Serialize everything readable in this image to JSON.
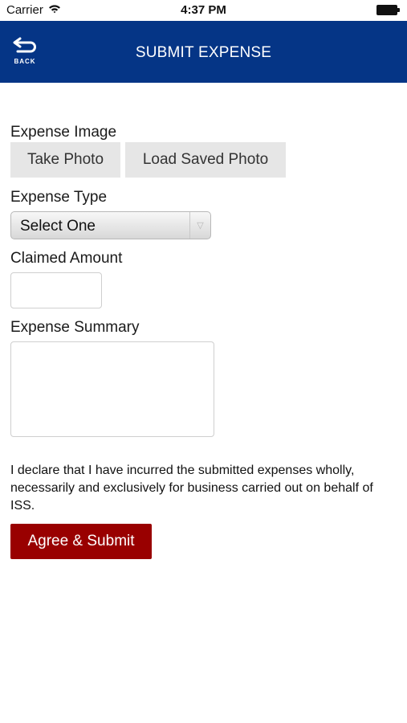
{
  "status_bar": {
    "carrier": "Carrier",
    "time": "4:37 PM",
    "wifi_icon": "wifi-icon",
    "battery_icon": "battery-icon"
  },
  "nav": {
    "back_label": "BACK",
    "back_icon": "back-arrow-icon",
    "title": "SUBMIT EXPENSE",
    "background_color": "#053586"
  },
  "form": {
    "expense_image_label": "Expense Image",
    "take_photo_label": "Take Photo",
    "load_saved_photo_label": "Load Saved Photo",
    "expense_type_label": "Expense Type",
    "expense_type_selected": "Select One",
    "claimed_amount_label": "Claimed Amount",
    "claimed_amount_value": "",
    "expense_summary_label": "Expense Summary",
    "expense_summary_value": "",
    "declaration_text": "I declare that I have incurred the submitted expenses wholly, necessarily and exclusively for business carried out on behalf of ISS.",
    "submit_label": "Agree & Submit",
    "submit_color": "#990000"
  }
}
